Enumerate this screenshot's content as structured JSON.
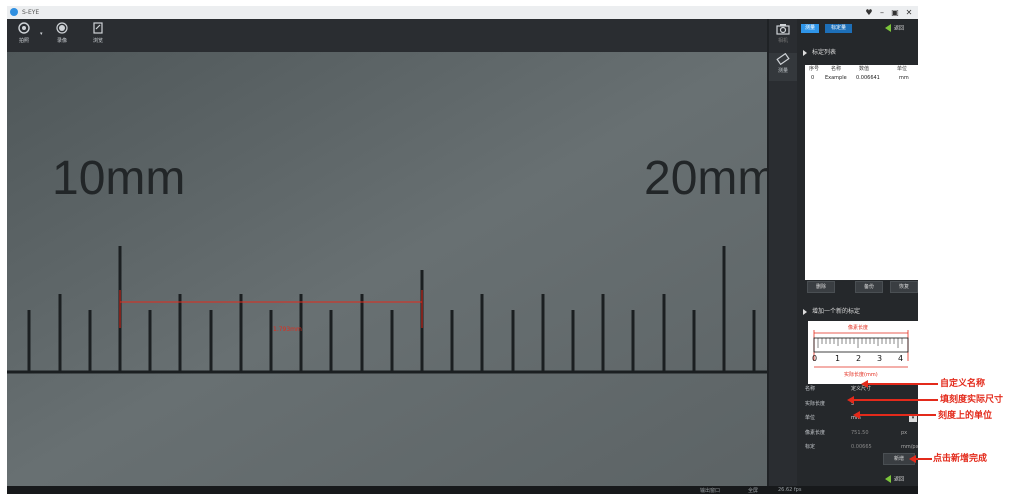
{
  "app": {
    "title": "S-EYE"
  },
  "toolbar": {
    "capture_label": "拍照",
    "record_label": "录像",
    "browse_label": "浏览"
  },
  "image": {
    "label_10": "10mm",
    "label_20": "20mm",
    "measure_value": "1.793mm"
  },
  "sidebar": {
    "camera_label": "相机",
    "measure_label": "测量"
  },
  "panel": {
    "crumb_measure": "测量",
    "crumb_calibration": "标定量",
    "back_label": "返回",
    "calibration_list_title": "标定列表",
    "table_headers": [
      "序号",
      "名称",
      "数值",
      "单位"
    ],
    "table_rows": [
      [
        "0",
        "Example",
        "0.006641",
        "mm"
      ]
    ],
    "delete_label": "删除",
    "backup_label": "备份",
    "restore_label": "恢复",
    "add_new_title": "增加一个新的标定",
    "ruler": {
      "pixel_length_label": "像素长度",
      "actual_length_label": "实际长度(mm)",
      "ticks": [
        "0",
        "1",
        "2",
        "3",
        "4"
      ]
    },
    "fields": {
      "name_label": "名称",
      "name_value": "定义尺寸",
      "actual_label": "实际长度",
      "actual_value": "5",
      "unit_label": "单位",
      "unit_value": "mm",
      "pixel_label": "像素长度",
      "pixel_value": "751.50",
      "pixel_unit": "px",
      "calib_label": "标定",
      "calib_value": "0.00665",
      "calib_unit": "mm/px"
    },
    "new_button_label": "新增",
    "back_label_bottom": "返回"
  },
  "status": {
    "output_window": "输出窗口",
    "fullscreen": "全屏",
    "fps": "26.62 fps"
  },
  "annotations": {
    "custom_name": "自定义名称",
    "fill_actual": "填刻度实际尺寸",
    "unit_on_scale": "刻度上的单位",
    "click_new": "点击新增完成"
  },
  "colors": {
    "accent": "#2f95e8",
    "annotation": "#e32a1b",
    "back_arrow": "#7cc63a"
  }
}
